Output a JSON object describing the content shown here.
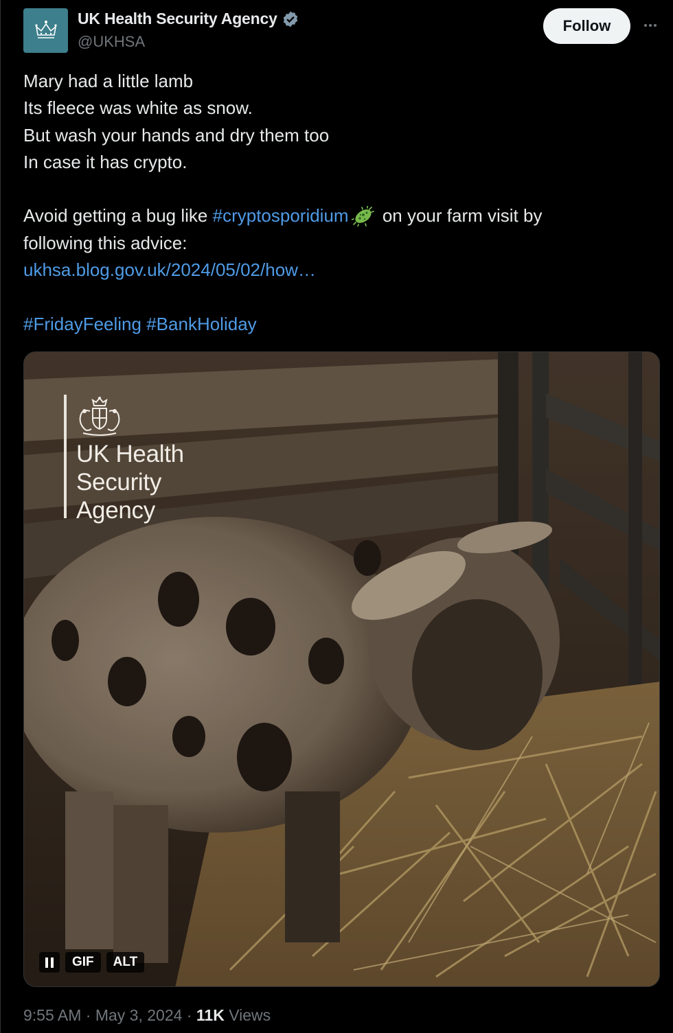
{
  "account": {
    "display_name": "UK Health Security Agency",
    "handle": "@UKHSA",
    "verified": true,
    "avatar_icon": "crown-icon",
    "avatar_color": "#3d7f8c"
  },
  "actions": {
    "follow_label": "Follow",
    "more_icon": "more-options-icon"
  },
  "tweet": {
    "lines": [
      "Mary had a little lamb",
      "Its fleece was white as snow.",
      "But wash your hands and dry them too",
      "In case it has crypto."
    ],
    "advice_prefix": "Avoid getting a bug like ",
    "hashtag_crypto": "#cryptosporidium",
    "emoji_icon": "microbe-icon",
    "advice_suffix": " on your farm visit by",
    "advice_line2": "following this advice:",
    "link": "ukhsa.blog.gov.uk/2024/05/02/how…",
    "hashtags": [
      "#FridayFeeling",
      "#BankHoliday"
    ],
    "link_color": "#4f9be6"
  },
  "media": {
    "logo_text": [
      "UK Health",
      "Security",
      "Agency"
    ],
    "logo_icon": "royal-crest-icon",
    "pause_icon": "pause-icon",
    "gif_label": "GIF",
    "alt_label": "ALT"
  },
  "meta": {
    "time": "9:55 AM",
    "separator": "·",
    "date": "May 3, 2024",
    "views_count": "11K",
    "views_label": "Views"
  }
}
